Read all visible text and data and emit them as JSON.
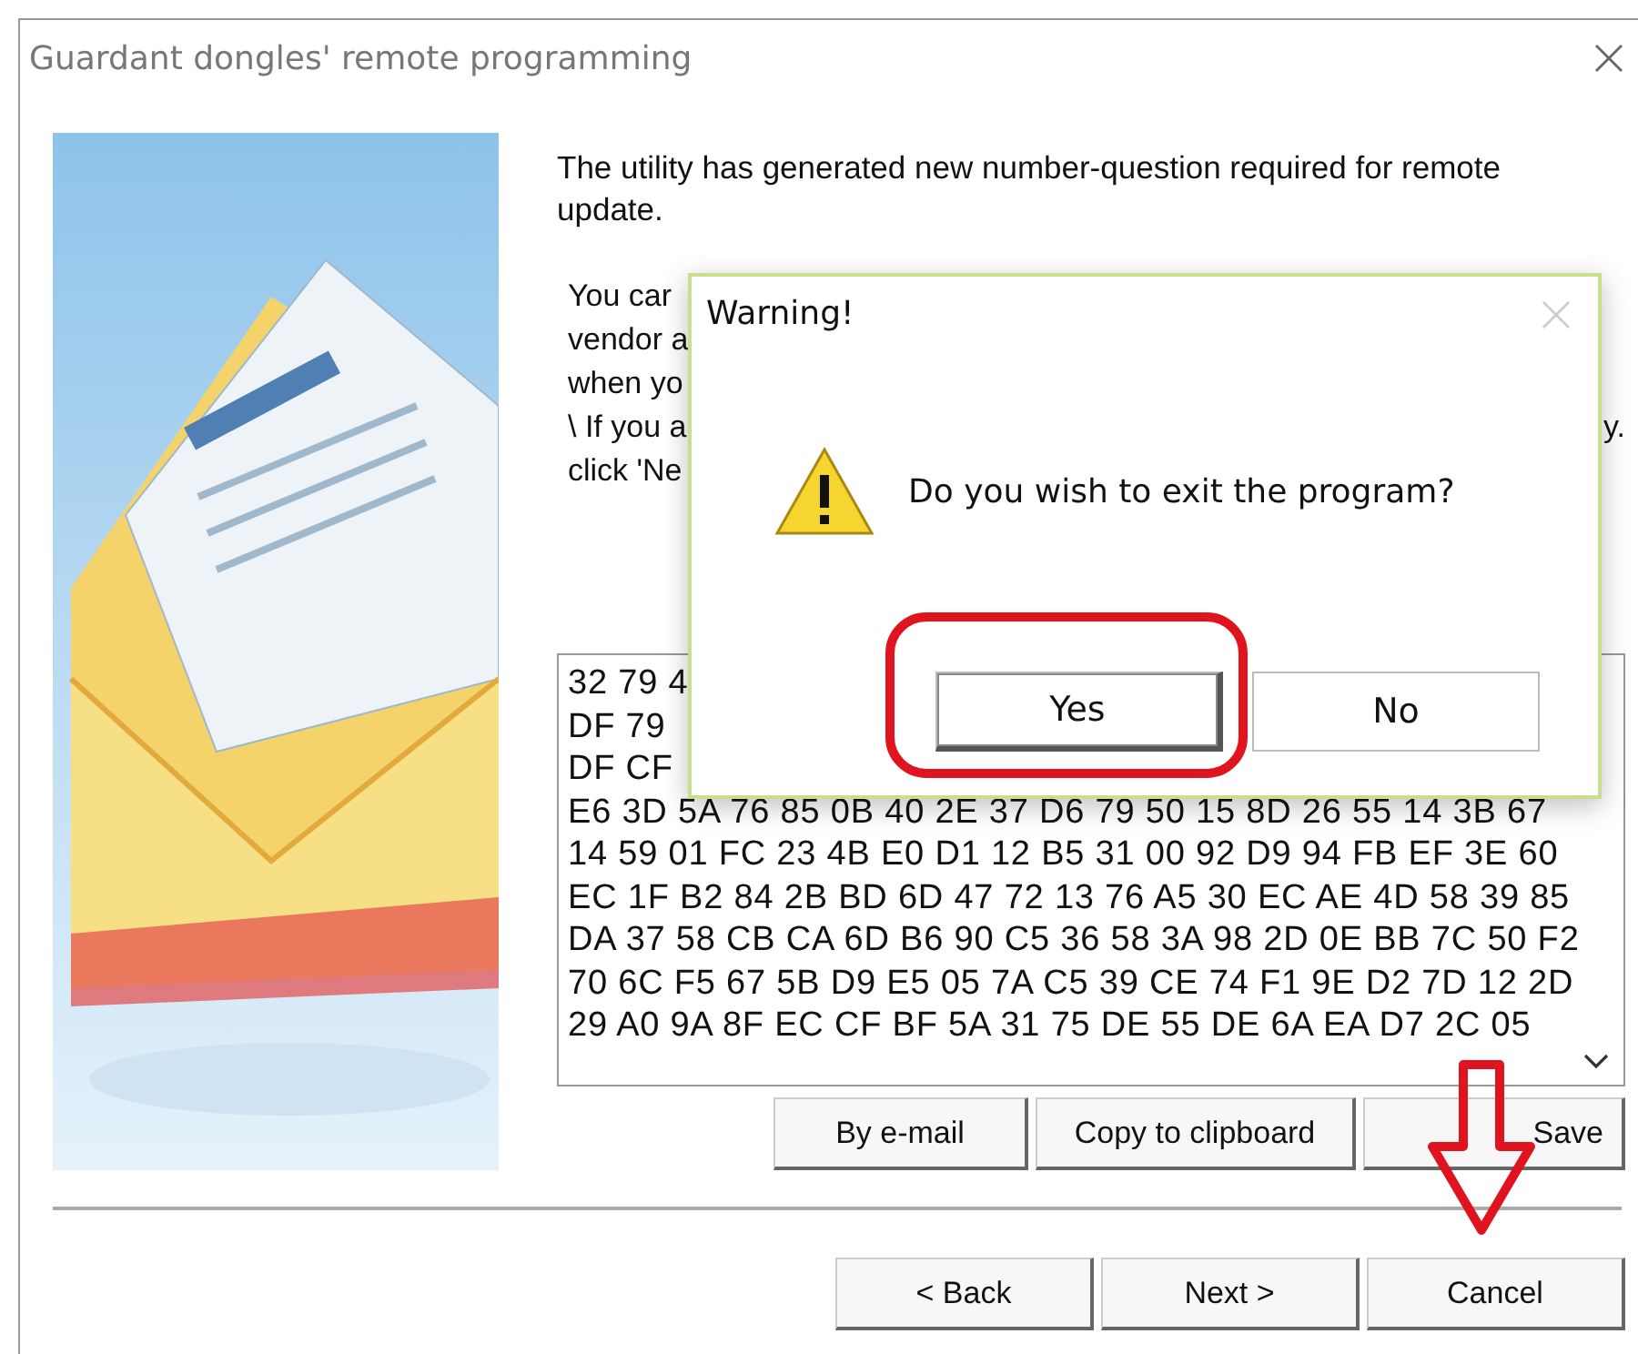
{
  "window": {
    "title": "Guardant dongles' remote programming"
  },
  "intro": "The utility has generated new number-question required for remote update.",
  "instructions": [
    {
      "text": "You car"
    },
    {
      "text": "vendor a"
    },
    {
      "text": "when yo"
    },
    {
      "text": "\\ If you a",
      "tail": "y."
    },
    {
      "text": "click 'Ne"
    }
  ],
  "question_lines": [
    "32 79 4",
    "DF 79",
    "DF CF",
    "E6 3D 5A 76 85 0B 40 2E 37 D6 79 50 15 8D 26 55 14 3B 67",
    "14 59 01 FC 23 4B E0 D1 12 B5 31 00 92 D9 94 FB EF 3E 60",
    "EC 1F B2 84 2B BD 6D 47 72 13 76 A5 30 EC AE 4D 58 39 85",
    "DA 37 58 CB CA 6D B6 90 C5 36 58 3A 98 2D 0E BB 7C 50 F2",
    "70 6C F5 67 5B D9 E5 05 7A C5 39 CE 74 F1 9E D2 7D 12 2D",
    "29 A0 9A 8F EC CF BF 5A 31 75 DE 55 DE 6A EA D7 2C 05"
  ],
  "actions": [
    "By e-mail",
    "Copy to clipboard",
    "Save"
  ],
  "nav": [
    "< Back",
    "Next >",
    "Cancel"
  ],
  "dialog": {
    "title": "Warning!",
    "message": "Do you wish to exit the program?",
    "buttons": [
      {
        "label": "Yes",
        "selected": true
      },
      {
        "label": "No",
        "selected": false
      }
    ]
  }
}
